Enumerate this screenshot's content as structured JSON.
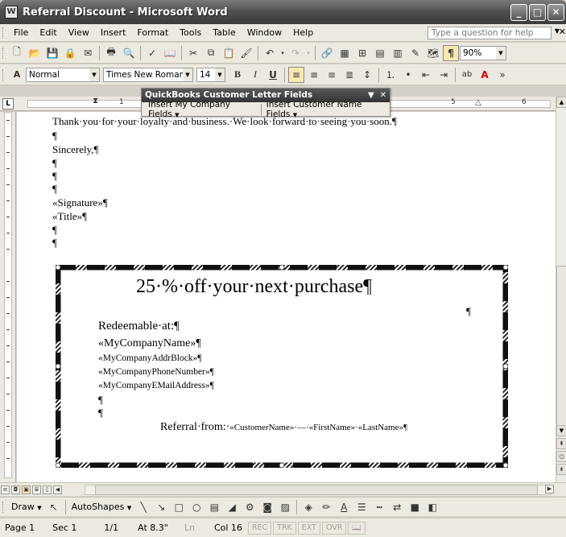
{
  "window": {
    "title": "Referral Discount - Microsoft Word"
  },
  "menubar": {
    "items": [
      "File",
      "Edit",
      "View",
      "Insert",
      "Format",
      "Tools",
      "Table",
      "Window",
      "Help"
    ],
    "help_placeholder": "Type a question for help"
  },
  "standard_toolbar": {
    "zoom": "90%"
  },
  "formatting_toolbar": {
    "style": "Normal",
    "font": "Times New Roman",
    "size": "14"
  },
  "qb_toolbar": {
    "title": "QuickBooks Customer Letter Fields",
    "btn1": "Insert My Company Fields",
    "btn2": "Insert Customer Name Fields"
  },
  "ruler": {
    "n1": "1",
    "n5": "5",
    "n6": "6"
  },
  "document": {
    "line1": "Thank·you·for·your·loyalty·and·business.·We·look·forward·to·seeing·you·soon.¶",
    "sincerely": "Sincerely,¶",
    "signature": "«Signature»¶",
    "title": "«Title»¶",
    "pilcrow": "¶",
    "coupon_heading": "25·%·off·your·next·purchase¶",
    "redeemable": "Redeemable·at:¶",
    "company_name": "«MyCompanyName»¶",
    "company_addr": "«MyCompanyAddrBlock»¶",
    "company_phone": "«MyCompanyPhoneNumber»¶",
    "company_email": "«MyCompanyEMailAddress»¶",
    "referral_prefix": "Referral·from:·",
    "referral_fields": "«CustomerName»·—·«FirstName»·«LastName»¶"
  },
  "drawbar": {
    "draw": "Draw",
    "autoshapes": "AutoShapes"
  },
  "statusbar": {
    "page": "Page 1",
    "sec": "Sec 1",
    "pages": "1/1",
    "at": "At 8.3\"",
    "ln": "Ln",
    "col": "Col 16",
    "rec": "REC",
    "trk": "TRK",
    "ext": "EXT",
    "ovr": "OVR"
  }
}
